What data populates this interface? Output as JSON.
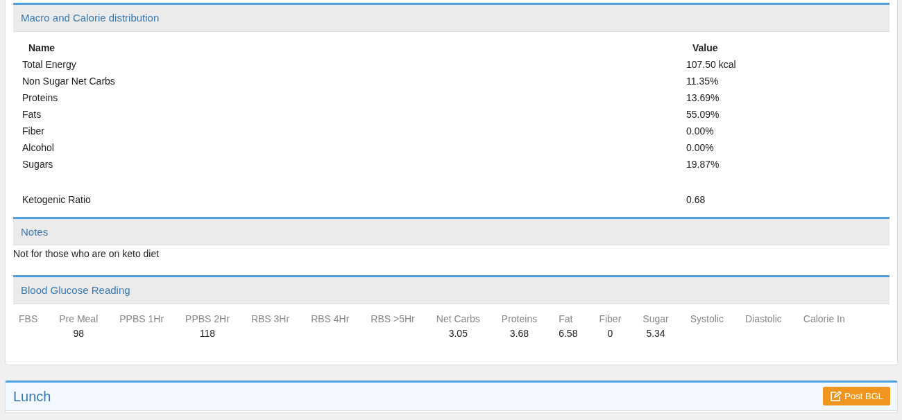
{
  "macro_panel": {
    "title": "Macro and Calorie distribution",
    "columns": [
      "Name",
      "Value"
    ],
    "rows": [
      {
        "name": "Total Energy",
        "value": "107.50 kcal"
      },
      {
        "name": "Non Sugar Net Carbs",
        "value": "11.35%"
      },
      {
        "name": "Proteins",
        "value": "13.69%"
      },
      {
        "name": "Fats",
        "value": "55.09%"
      },
      {
        "name": "Fiber",
        "value": "0.00%"
      },
      {
        "name": "Alcohol",
        "value": "0.00%"
      },
      {
        "name": "Sugars",
        "value": "19.87%"
      }
    ],
    "summary_rows": [
      {
        "name": "Ketogenic Ratio",
        "value": "0.68"
      }
    ]
  },
  "notes_panel": {
    "title": "Notes",
    "text": "Not for those who are on keto diet"
  },
  "glucose_panel": {
    "title": "Blood Glucose Reading",
    "columns": [
      {
        "label": "FBS"
      },
      {
        "label": "Pre Meal",
        "value": "98"
      },
      {
        "label": "PPBS 1Hr"
      },
      {
        "label": "PPBS 2Hr",
        "value": "118"
      },
      {
        "label": "RBS 3Hr"
      },
      {
        "label": "RBS 4Hr"
      },
      {
        "label": "RBS >5Hr"
      },
      {
        "label": "Net Carbs",
        "value": "3.05"
      },
      {
        "label": "Proteins",
        "value": "3.68"
      },
      {
        "label": "Fat",
        "value": "6.58"
      },
      {
        "label": "Fiber",
        "value": "0"
      },
      {
        "label": "Sugar",
        "value": "5.34"
      },
      {
        "label": "Systolic"
      },
      {
        "label": "Diastolic"
      },
      {
        "label": "Calorie In"
      }
    ]
  },
  "meal_card": {
    "title": "Lunch",
    "button": "Post BGL"
  }
}
